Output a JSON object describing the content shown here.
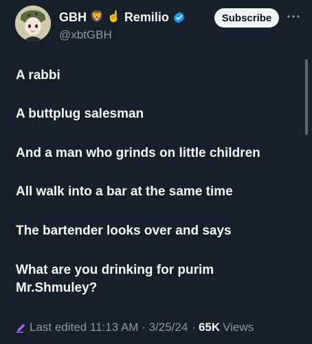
{
  "header": {
    "display_name": "GBH",
    "name_suffix": "Remilio",
    "emojis": [
      "🦁",
      "☝️"
    ],
    "handle": "@xbtGBH",
    "subscribe_label": "Subscribe",
    "verified_color": "#1d9bf0"
  },
  "tweet": {
    "lines": [
      "A rabbi",
      "A buttplug salesman",
      "And a man who grinds on little children",
      "All walk into a bar at the same time",
      "The bartender looks over and says",
      "What are you drinking for purim",
      "Mr.Shmuley?"
    ]
  },
  "meta": {
    "edited": "Last edited 11:13 AM · 3/25/24",
    "separator": "·",
    "views_count": "65K",
    "views_label": "Views",
    "edit_icon_color": "#a56bff"
  }
}
